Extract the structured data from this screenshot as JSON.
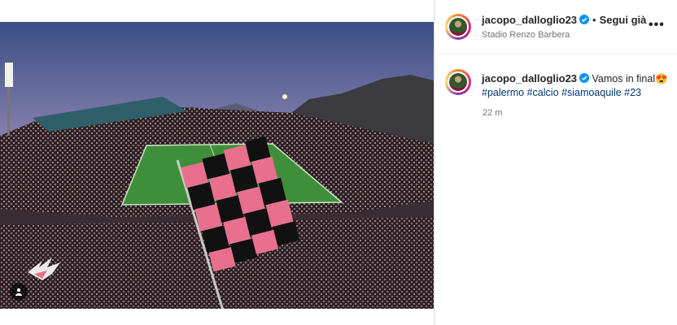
{
  "post": {
    "username": "jacopo_dalloglio23",
    "follow_label": "Segui già",
    "location": "Stadio Renzo Barbera",
    "caption_text": "Vamos in final😍",
    "hashtags": [
      "#palermo",
      "#calcio",
      "#siamoaquile",
      "#23"
    ],
    "time_ago": "22 m"
  },
  "icons": {
    "verified": "verified-badge-icon",
    "more": "more-options-icon",
    "tag": "user-tag-icon",
    "logo": "palermo-eagle-logo"
  },
  "colors": {
    "verified_blue": "#0095f6",
    "link": "#00376b",
    "muted": "#737373",
    "flag_pink": "#e8708e",
    "flag_black": "#111111",
    "pitch": "#3f8f3a"
  }
}
